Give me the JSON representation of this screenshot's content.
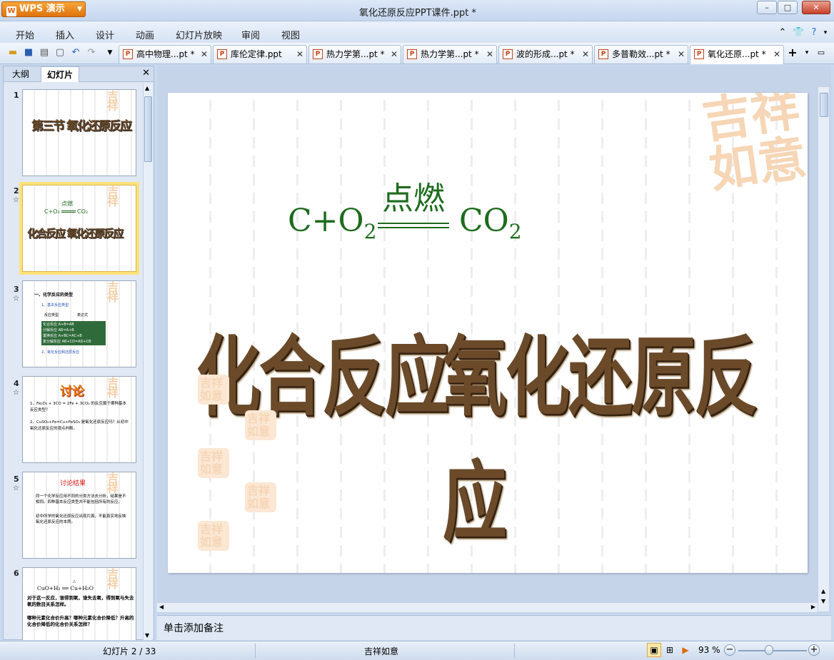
{
  "window": {
    "app_name": "WPS 演示",
    "title": "氧化还原反应PPT课件.ppt *"
  },
  "menu": [
    "开始",
    "插入",
    "设计",
    "动画",
    "幻灯片放映",
    "审阅",
    "视图"
  ],
  "doc_tabs": [
    {
      "label": "高中物理...pt *",
      "active": false
    },
    {
      "label": "库伦定律.ppt",
      "active": false
    },
    {
      "label": "热力学第...pt *",
      "active": false
    },
    {
      "label": "热力学第...pt *",
      "active": false
    },
    {
      "label": "波的形成...pt *",
      "active": false
    },
    {
      "label": "多普勒效...pt *",
      "active": false
    },
    {
      "label": "氧化还原...pt *",
      "active": true
    }
  ],
  "sidebar": {
    "tabs": [
      "大纲",
      "幻灯片"
    ],
    "active_tab": "幻灯片",
    "slides": [
      {
        "num": "1",
        "star": false,
        "title": "第三节 氧化还原反应"
      },
      {
        "num": "2",
        "star": true,
        "selected": true,
        "eq_top": "点燃",
        "eq_left": "C+O₂",
        "eq_right": "CO₂",
        "title": "化合反应  氧化还原反应"
      },
      {
        "num": "3",
        "star": true,
        "heading": "一、化学反应的类型",
        "sub1": "1、基本反应类型",
        "col1": "反应类型",
        "col2": "表达式",
        "rows": [
          [
            "化合反应",
            "A+B=AB"
          ],
          [
            "分解反应",
            "AB=A+B"
          ],
          [
            "置换反应",
            "A+BC=AC+B"
          ],
          [
            "复分解反应",
            "AB+CD=AD+CB"
          ]
        ],
        "sub2": "2、氧化反应和还原反应"
      },
      {
        "num": "4",
        "star": true,
        "title": "讨论",
        "q1": "1、Fe₂O₃ + 3CO = 2Fe + 3CO₂ 的反应属于哪种基本反应类型？",
        "q2": "2、CuSO₄+Fe=Cu+FeSO₄ 是氧化还原反应吗？从初中氧化还原反应的观点判断。"
      },
      {
        "num": "5",
        "star": true,
        "title": "讨论结果",
        "p1": "同一个化学反应用不同的分类方法去分析，结果是不相同。四种基本反应类型并不能包括所有的反应。",
        "p2": "初中所学的氧化还原反应出现片面，不能真实地反映氧化还原反应的本质。"
      },
      {
        "num": "6",
        "star": false,
        "eq": "CuO+H₂ ══ Cu+H₂O",
        "heat": "△",
        "p1": "对于这一反应，谁得到氧，谁失去氧，得到氧与失去氧的数目关系怎样。",
        "p2": "哪种元素化合价升高？哪种元素化合价降低？升高的化合价降低的化合价关系怎样？"
      }
    ]
  },
  "slide": {
    "eq_left": "C+O",
    "eq_left_sub": "2",
    "eq_condition": "点燃",
    "eq_right": "CO",
    "eq_right_sub": "2",
    "title_a": "化合反应",
    "title_b": "氧化还原反应",
    "watermark": "吉祥如意"
  },
  "notes_placeholder": "单击添加备注",
  "status": {
    "slide_counter": "幻灯片 2 / 33",
    "theme": "吉祥如意",
    "zoom": "93 %"
  },
  "colors": {
    "equation": "#1e6b1e",
    "accent_orange": "#e0730c",
    "selection": "#ffe27a"
  }
}
